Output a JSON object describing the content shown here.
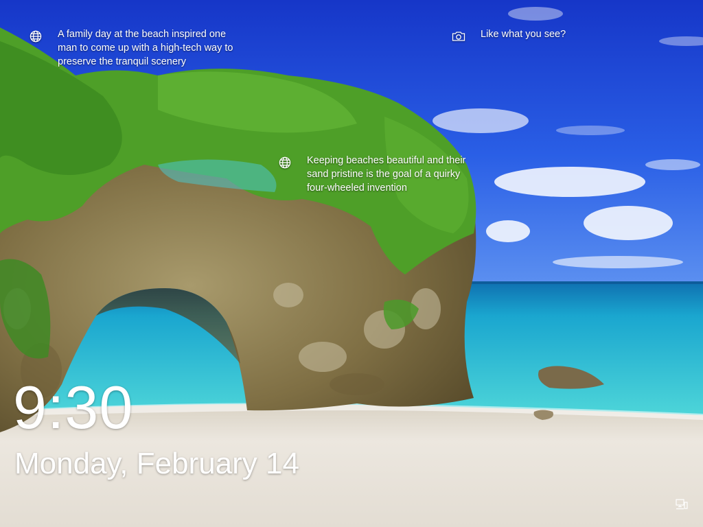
{
  "spotlight": {
    "item1": {
      "icon": "globe-icon",
      "text": "A family day at the beach inspired one man to come up with a high-tech way to preserve the tranquil scenery"
    },
    "item2": {
      "icon": "camera-icon",
      "text": "Like what you see?"
    },
    "item3": {
      "icon": "globe-icon",
      "text": "Keeping beaches beautiful and their sand pristine is the goal of a quirky four-wheeled invention"
    }
  },
  "lock": {
    "time": "9:30",
    "date": "Monday, February 14"
  },
  "status": {
    "network_icon": "network-icon"
  },
  "colors": {
    "sky": "#1a3fd6",
    "sea": "#38c9d3",
    "sand": "#e9e3da",
    "vegetation": "#4a9b2a",
    "rock": "#8a7a52",
    "text": "#ffffff"
  }
}
